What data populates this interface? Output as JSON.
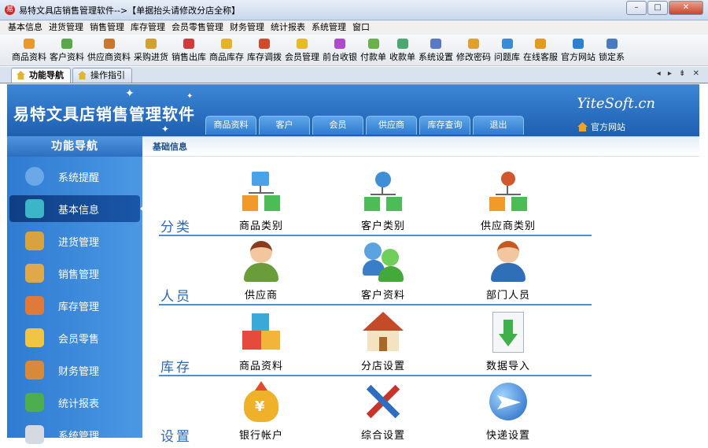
{
  "window": {
    "title": "易特文具店销售管理软件-->【单据抬头请修改分店全称】",
    "min": "–",
    "max": "□",
    "close": "✕"
  },
  "menu": [
    "基本信息",
    "进货管理",
    "销售管理",
    "库存管理",
    "会员零售管理",
    "财务管理",
    "统计报表",
    "系统管理",
    "窗口"
  ],
  "toolbar": [
    {
      "label": "商品资料",
      "color": "#e79a2b"
    },
    {
      "label": "客户资料",
      "color": "#5aa84a"
    },
    {
      "label": "供应商资料",
      "color": "#c9772e"
    },
    {
      "label": "采购进货",
      "color": "#d2a030"
    },
    {
      "label": "销售出库",
      "color": "#cf3a3a"
    },
    {
      "label": "商品库存",
      "color": "#e6b22c"
    },
    {
      "label": "库存调拨",
      "color": "#d04a2c"
    },
    {
      "label": "会员管理",
      "color": "#e8b92a"
    },
    {
      "label": "前台收银",
      "color": "#b04acc"
    },
    {
      "label": "付款单",
      "color": "#6ab04c"
    },
    {
      "label": "收款单",
      "color": "#4ca86e"
    },
    {
      "label": "系统设置",
      "color": "#5a78c8"
    },
    {
      "label": "修改密码",
      "color": "#e2a12a"
    },
    {
      "label": "问题库",
      "color": "#3a8ad4"
    },
    {
      "label": "在线客服",
      "color": "#e29a22"
    },
    {
      "label": "官方网站",
      "color": "#2d7fd0"
    },
    {
      "label": "锁定系",
      "color": "#4a7ac0"
    }
  ],
  "tabs": [
    {
      "label": "功能导航",
      "active": true
    },
    {
      "label": "操作指引",
      "active": false
    }
  ],
  "tab_controls": "◂ ▸ ⇟ ✕",
  "banner": {
    "title": "易特文具店销售管理软件",
    "brand": "YiteSoft.cn",
    "home_link": "官方网站"
  },
  "topnav": [
    "商品资料",
    "客户",
    "会员",
    "供应商",
    "库存查询",
    "退出"
  ],
  "sidebar": {
    "heading": "功能导航",
    "items": [
      {
        "label": "系统提醒",
        "color": "#6aa8e8",
        "active": false
      },
      {
        "label": "基本信息",
        "color": "#3bb6c9",
        "active": true
      },
      {
        "label": "进货管理",
        "color": "#d9a240",
        "active": false
      },
      {
        "label": "销售管理",
        "color": "#e0a84a",
        "active": false
      },
      {
        "label": "库存管理",
        "color": "#e07a3a",
        "active": false
      },
      {
        "label": "会员零售",
        "color": "#f0c542",
        "active": false
      },
      {
        "label": "财务管理",
        "color": "#d8893a",
        "active": false
      },
      {
        "label": "统计报表",
        "color": "#4cae4c",
        "active": false
      },
      {
        "label": "系统管理",
        "color": "#d4d9e2",
        "active": false
      }
    ]
  },
  "content": {
    "heading": "基础信息",
    "sections": [
      {
        "label": "分类",
        "items": [
          {
            "label": "商品类别",
            "icon": "product-category-icon"
          },
          {
            "label": "客户类别",
            "icon": "customer-category-icon"
          },
          {
            "label": "供应商类别",
            "icon": "supplier-category-icon"
          }
        ]
      },
      {
        "label": "人员",
        "items": [
          {
            "label": "供应商",
            "icon": "supplier-person-icon"
          },
          {
            "label": "客户资料",
            "icon": "customer-people-icon"
          },
          {
            "label": "部门人员",
            "icon": "department-staff-icon"
          }
        ]
      },
      {
        "label": "库存",
        "items": [
          {
            "label": "商品资料",
            "icon": "product-cubes-icon"
          },
          {
            "label": "分店设置",
            "icon": "branch-house-icon"
          },
          {
            "label": "数据导入",
            "icon": "data-import-icon"
          }
        ]
      },
      {
        "label": "设置",
        "items": [
          {
            "label": "银行帐户",
            "icon": "bank-account-icon"
          },
          {
            "label": "综合设置",
            "icon": "general-settings-icon"
          },
          {
            "label": "快递设置",
            "icon": "express-settings-icon"
          }
        ]
      }
    ]
  }
}
